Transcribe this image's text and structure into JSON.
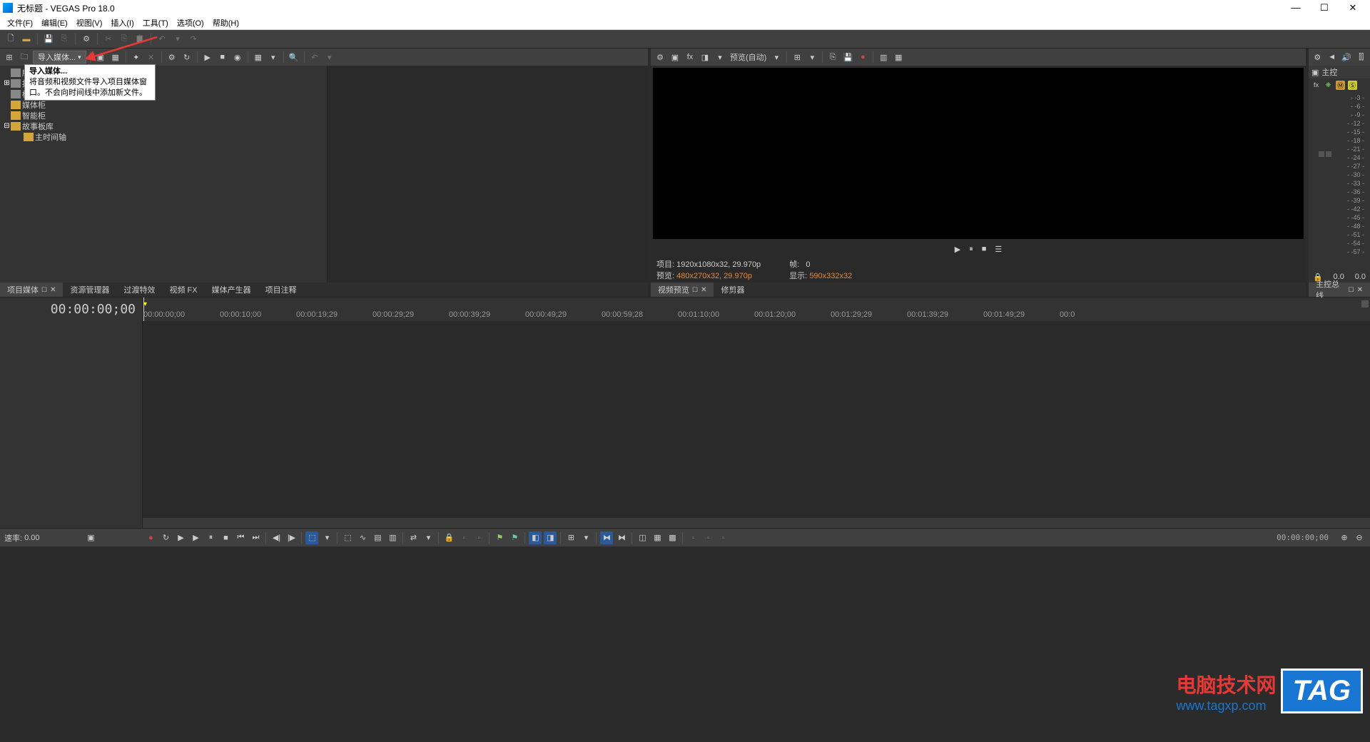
{
  "window": {
    "title": "无标题 - VEGAS Pro 18.0",
    "min": "—",
    "max": "☐",
    "close": "✕"
  },
  "menu": [
    "文件(F)",
    "编辑(E)",
    "视图(V)",
    "插入(I)",
    "工具(T)",
    "选项(O)",
    "帮助(H)"
  ],
  "toolbar_project": {
    "import_label": "导入媒体...",
    "dropdown_chev": "▾"
  },
  "tooltip": {
    "title": "导入媒体...",
    "line1": "将音频和视频文件导入项目媒体窗",
    "line2": "口。不会向时间线中添加新文件。"
  },
  "media_tree": {
    "rows": [
      {
        "exp": "",
        "label": "所",
        "folder": false
      },
      {
        "exp": "⊞",
        "label": "按",
        "folder": false
      },
      {
        "exp": "",
        "label": "标",
        "folder": false
      },
      {
        "exp": "",
        "label": "媒体柜",
        "folder": true
      },
      {
        "exp": "",
        "label": "智能柜",
        "folder": true
      },
      {
        "exp": "⊟",
        "label": "故事板库",
        "folder": true
      },
      {
        "exp": "",
        "label": "主时间轴",
        "folder": true,
        "indent": true
      }
    ]
  },
  "tabs_left": [
    "项目媒体",
    "资源管理器",
    "过渡特效",
    "视频 FX",
    "媒体产生器",
    "项目注释"
  ],
  "preview": {
    "toolbar_quality": "预览(自动)",
    "status_project_label": "项目:",
    "status_project_val": "1920x1080x32, 29.970p",
    "status_preview_label": "预览:",
    "status_preview_val": "480x270x32, 29.970p",
    "status_frame_label": "帧:",
    "status_frame_val": "0",
    "status_display_label": "显示:",
    "status_display_val": "590x332x32"
  },
  "tabs_right": [
    "视频预览",
    "修剪器"
  ],
  "master": {
    "header": "主控",
    "bottom_l": "0.0",
    "bottom_r": "0.0",
    "tab": "主控总线",
    "ticks": [
      "-3",
      "-6",
      "-9",
      "-12",
      "-15",
      "-18",
      "-21",
      "-24",
      "-27",
      "-30",
      "-33",
      "-36",
      "-39",
      "-42",
      "-45",
      "-48",
      "-51",
      "-54",
      "-57"
    ]
  },
  "timeline": {
    "timecode": "00:00:00;00",
    "ruler": [
      "00:00:00;00",
      "00:00:10;00",
      "00:00:19;29",
      "00:00:29;29",
      "00:00:39;29",
      "00:00:49;29",
      "00:00:59;28",
      "00:01:10;00",
      "00:01:20;00",
      "00:01:29;29",
      "00:01:39;29",
      "00:01:49;29",
      "00:0"
    ]
  },
  "status": {
    "rate_label": "速率:",
    "rate_val": "0.00",
    "tc_end": "00:00:00;00"
  },
  "watermark": {
    "text": "电脑技术网",
    "url": "www.tagxp.com",
    "tag": "TAG"
  }
}
